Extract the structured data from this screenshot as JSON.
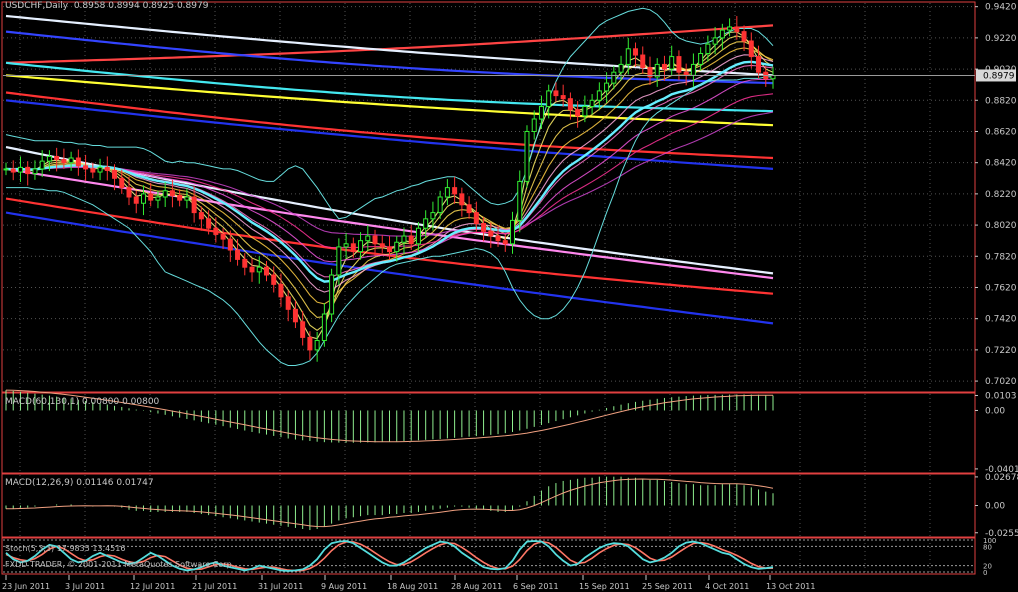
{
  "chart_data": [
    {
      "type": "candlestick",
      "title": "USDCHF,Daily",
      "ohlc_header": [
        "0.8958",
        "0.8994",
        "0.8925",
        "0.8979"
      ],
      "current_price": 0.8979,
      "current_price_label": "0.8979",
      "ylim": [
        0.695,
        0.945
      ],
      "y_ticks": [
        0.702,
        0.722,
        0.742,
        0.762,
        0.782,
        0.802,
        0.822,
        0.842,
        0.862,
        0.882,
        0.902,
        0.922,
        0.942
      ],
      "y_tick_labels": [
        "0.7020",
        "0.7220",
        "0.7420",
        "0.7620",
        "0.7820",
        "0.8020",
        "0.8220",
        "0.8420",
        "0.8620",
        "0.8820",
        "0.9020",
        "0.9220",
        "0.9420"
      ],
      "close": [
        0.838,
        0.836,
        0.839,
        0.835,
        0.838,
        0.843,
        0.846,
        0.844,
        0.842,
        0.845,
        0.84,
        0.838,
        0.836,
        0.839,
        0.837,
        0.832,
        0.826,
        0.82,
        0.816,
        0.822,
        0.818,
        0.82,
        0.824,
        0.821,
        0.818,
        0.82,
        0.81,
        0.806,
        0.8,
        0.796,
        0.793,
        0.786,
        0.78,
        0.775,
        0.772,
        0.775,
        0.77,
        0.764,
        0.756,
        0.748,
        0.74,
        0.73,
        0.722,
        0.728,
        0.745,
        0.77,
        0.788,
        0.79,
        0.785,
        0.792,
        0.795,
        0.79,
        0.788,
        0.785,
        0.791,
        0.795,
        0.79,
        0.8,
        0.806,
        0.81,
        0.82,
        0.826,
        0.822,
        0.815,
        0.81,
        0.803,
        0.798,
        0.795,
        0.792,
        0.79,
        0.805,
        0.83,
        0.862,
        0.87,
        0.878,
        0.888,
        0.885,
        0.883,
        0.876,
        0.872,
        0.878,
        0.882,
        0.888,
        0.893,
        0.9,
        0.905,
        0.915,
        0.911,
        0.903,
        0.897,
        0.905,
        0.902,
        0.91,
        0.9,
        0.898,
        0.905,
        0.912,
        0.918,
        0.922,
        0.927,
        0.929,
        0.926,
        0.92,
        0.91,
        0.9,
        0.8958,
        0.8979
      ],
      "oscillators_on_main": {
        "bollinger_upper": [
          0.86,
          0.859,
          0.858,
          0.857,
          0.856,
          0.856,
          0.856,
          0.856,
          0.855,
          0.855,
          0.854,
          0.854,
          0.853,
          0.853,
          0.852,
          0.852,
          0.852,
          0.852,
          0.852,
          0.851,
          0.849,
          0.846,
          0.843,
          0.842,
          0.843,
          0.842,
          0.842,
          0.841,
          0.84,
          0.839,
          0.838,
          0.838,
          0.837,
          0.835,
          0.833,
          0.831,
          0.83,
          0.83,
          0.834,
          0.838,
          0.84,
          0.838,
          0.832,
          0.826,
          0.819,
          0.812,
          0.806,
          0.807,
          0.81,
          0.813,
          0.816,
          0.819,
          0.82,
          0.822,
          0.824,
          0.825,
          0.827,
          0.828,
          0.83,
          0.831,
          0.832,
          0.833,
          0.833,
          0.831,
          0.827,
          0.823,
          0.819,
          0.816,
          0.815,
          0.816,
          0.818,
          0.825,
          0.838,
          0.853,
          0.868,
          0.883,
          0.894,
          0.903,
          0.91,
          0.915,
          0.92,
          0.925,
          0.93,
          0.933,
          0.935,
          0.937,
          0.939,
          0.94,
          0.941,
          0.94,
          0.937,
          0.932,
          0.926,
          0.922,
          0.92,
          0.919,
          0.918,
          0.919,
          0.921,
          0.924,
          0.926,
          0.928,
          0.928,
          0.928,
          0.926,
          0.922,
          0.917
        ],
        "bollinger_lower": [
          0.826,
          0.826,
          0.826,
          0.826,
          0.825,
          0.825,
          0.824,
          0.824,
          0.823,
          0.821,
          0.819,
          0.817,
          0.815,
          0.812,
          0.809,
          0.806,
          0.803,
          0.8,
          0.795,
          0.79,
          0.785,
          0.778,
          0.772,
          0.77,
          0.768,
          0.766,
          0.764,
          0.762,
          0.76,
          0.757,
          0.754,
          0.75,
          0.745,
          0.739,
          0.733,
          0.727,
          0.722,
          0.718,
          0.714,
          0.712,
          0.712,
          0.713,
          0.715,
          0.72,
          0.728,
          0.736,
          0.744,
          0.75,
          0.755,
          0.76,
          0.764,
          0.768,
          0.772,
          0.775,
          0.777,
          0.778,
          0.779,
          0.78,
          0.781,
          0.782,
          0.782,
          0.783,
          0.784,
          0.785,
          0.786,
          0.787,
          0.786,
          0.784,
          0.78,
          0.772,
          0.762,
          0.754,
          0.748,
          0.744,
          0.742,
          0.742,
          0.744,
          0.748,
          0.754,
          0.762,
          0.772,
          0.784,
          0.797,
          0.81,
          0.822,
          0.835,
          0.846,
          0.856,
          0.864,
          0.87,
          0.874,
          0.877,
          0.88,
          0.883,
          0.886,
          0.889,
          0.892,
          0.894,
          0.895,
          0.895,
          0.895,
          0.895,
          0.896,
          0.896,
          0.896,
          0.897,
          0.897
        ]
      },
      "moving_averages_color_ranges": [
        {
          "color": "#ff4444",
          "level_start": 0.906,
          "level_end": 0.93
        },
        {
          "color": "#3344ff",
          "level_start": 0.926,
          "level_end": 0.893
        },
        {
          "color": "#e6f0ff",
          "level_start": 0.936,
          "level_end": 0.898
        },
        {
          "color": "#44e8f0",
          "level_start": 0.906,
          "level_end": 0.875
        },
        {
          "color": "#ffff33",
          "level_start": 0.898,
          "level_end": 0.866
        },
        {
          "color": "#ff3333",
          "level_start": 0.887,
          "level_end": 0.845
        },
        {
          "color": "#2233ee",
          "level_start": 0.882,
          "level_end": 0.838
        },
        {
          "color": "#ff3333",
          "level_start": 0.819,
          "level_end": 0.758
        },
        {
          "color": "#2233ee",
          "level_start": 0.81,
          "level_end": 0.739
        },
        {
          "color": "#e6f0ff",
          "level_start": 0.852,
          "level_end": 0.771
        },
        {
          "color": "#ff88ee",
          "level_start": 0.838,
          "level_end": 0.768
        }
      ],
      "x_labels": [
        "23 Jun 2011",
        "3 Jul 2011",
        "12 Jul 2011",
        "21 Jul 2011",
        "31 Jul 2011",
        "9 Aug 2011",
        "18 Aug 2011",
        "28 Aug 2011",
        "6 Sep 2011",
        "15 Sep 2011",
        "25 Sep 2011",
        "4 Oct 2011",
        "13 Oct 2011"
      ]
    },
    {
      "type": "histogram",
      "title": "MACD(60,130,1)",
      "values_header": [
        "0.00800",
        "0.00800"
      ],
      "ylim": [
        -0.043,
        0.012
      ],
      "y_tick_labels": [
        "0.0103",
        "0.00",
        "-0.04019"
      ],
      "y_ticks": [
        0.0103,
        0.0,
        -0.04019
      ],
      "hist": [
        0.014,
        0.0134,
        0.0128,
        0.0122,
        0.0115,
        0.0109,
        0.0102,
        0.0095,
        0.0088,
        0.008,
        0.0073,
        0.0065,
        0.0057,
        0.0049,
        0.0041,
        0.0032,
        0.0024,
        0.0015,
        0.0006,
        -0.0003,
        -0.0012,
        -0.0021,
        -0.003,
        -0.004,
        -0.0049,
        -0.0059,
        -0.0068,
        -0.0078,
        -0.0088,
        -0.0098,
        -0.0108,
        -0.0118,
        -0.0128,
        -0.0138,
        -0.0148,
        -0.0157,
        -0.0166,
        -0.0175,
        -0.0184,
        -0.0193,
        -0.02,
        -0.0205,
        -0.021,
        -0.0215,
        -0.0218,
        -0.022,
        -0.0221,
        -0.0222,
        -0.0222,
        -0.0221,
        -0.022,
        -0.0219,
        -0.0217,
        -0.0215,
        -0.0213,
        -0.0211,
        -0.0208,
        -0.0205,
        -0.0202,
        -0.0199,
        -0.0196,
        -0.0192,
        -0.0188,
        -0.0184,
        -0.018,
        -0.0176,
        -0.0172,
        -0.0168,
        -0.0163,
        -0.0156,
        -0.0148,
        -0.0138,
        -0.0126,
        -0.0113,
        -0.01,
        -0.0087,
        -0.0073,
        -0.006,
        -0.0047,
        -0.0034,
        -0.0021,
        -0.0008,
        0.0005,
        0.0017,
        0.0029,
        0.004,
        0.005,
        0.0059,
        0.0067,
        0.0074,
        0.008,
        0.0086,
        0.0091,
        0.0095,
        0.0099,
        0.0102,
        0.0104,
        0.0106,
        0.0107,
        0.0108,
        0.0109,
        0.011,
        0.011,
        0.0109,
        0.0108,
        0.0106,
        0.0103
      ]
    },
    {
      "type": "histogram",
      "title": "MACD(12,26,9)",
      "values_header": [
        "0.01146",
        "0.01747"
      ],
      "ylim": [
        -0.0295,
        0.0295
      ],
      "y_tick_labels": [
        "0.02678",
        "0.00",
        "-0.02553"
      ],
      "y_ticks": [
        0.02678,
        0.0,
        -0.02553
      ],
      "hist": [
        -0.003,
        -0.003,
        -0.002,
        -0.002,
        -0.001,
        0.0,
        0.0,
        0.001,
        0.0,
        0.001,
        0.0,
        0.0,
        -0.001,
        0.0,
        0.0,
        -0.001,
        -0.002,
        -0.004,
        -0.005,
        -0.005,
        -0.006,
        -0.006,
        -0.006,
        -0.006,
        -0.006,
        -0.006,
        -0.007,
        -0.008,
        -0.009,
        -0.01,
        -0.011,
        -0.012,
        -0.013,
        -0.014,
        -0.015,
        -0.016,
        -0.017,
        -0.018,
        -0.019,
        -0.02,
        -0.021,
        -0.022,
        -0.023,
        -0.022,
        -0.02,
        -0.017,
        -0.014,
        -0.012,
        -0.011,
        -0.01,
        -0.009,
        -0.009,
        -0.009,
        -0.008,
        -0.008,
        -0.007,
        -0.007,
        -0.006,
        -0.005,
        -0.004,
        -0.003,
        -0.002,
        -0.001,
        -0.001,
        -0.002,
        -0.003,
        -0.004,
        -0.005,
        -0.006,
        -0.006,
        -0.005,
        -0.001,
        0.004,
        0.009,
        0.014,
        0.018,
        0.021,
        0.023,
        0.024,
        0.025,
        0.026,
        0.026,
        0.027,
        0.027,
        0.027,
        0.027,
        0.026,
        0.026,
        0.025,
        0.024,
        0.024,
        0.023,
        0.022,
        0.021,
        0.02,
        0.02,
        0.019,
        0.019,
        0.019,
        0.02,
        0.02,
        0.02,
        0.019,
        0.017,
        0.015,
        0.013,
        0.0115
      ],
      "signal_approx_tail": 0.01747
    },
    {
      "type": "line",
      "title": "Stoch(5,3,3)",
      "ylim": [
        0,
        100
      ],
      "y_tick_labels": [
        "100",
        "80",
        "20",
        "0"
      ],
      "y_ticks": [
        100,
        80,
        20,
        0
      ],
      "k": [
        60,
        40,
        30,
        35,
        50,
        70,
        85,
        80,
        60,
        40,
        30,
        35,
        50,
        60,
        50,
        40,
        30,
        25,
        30,
        45,
        60,
        50,
        35,
        20,
        10,
        5,
        8,
        15,
        25,
        30,
        20,
        15,
        10,
        5,
        10,
        20,
        15,
        10,
        5,
        3,
        5,
        8,
        20,
        40,
        70,
        90,
        95,
        97,
        90,
        75,
        60,
        45,
        30,
        20,
        20,
        30,
        45,
        60,
        75,
        85,
        95,
        92,
        80,
        60,
        45,
        30,
        15,
        10,
        8,
        12,
        35,
        70,
        95,
        97,
        95,
        80,
        55,
        35,
        20,
        25,
        45,
        60,
        75,
        85,
        90,
        88,
        80,
        60,
        40,
        30,
        35,
        45,
        60,
        80,
        92,
        95,
        90,
        80,
        70,
        60,
        55,
        40,
        25,
        15,
        10,
        12,
        15
      ],
      "d": [
        55,
        45,
        38,
        35,
        42,
        55,
        72,
        80,
        73,
        58,
        43,
        35,
        38,
        48,
        53,
        50,
        40,
        32,
        28,
        33,
        45,
        52,
        48,
        35,
        22,
        12,
        8,
        9,
        16,
        23,
        25,
        22,
        15,
        10,
        8,
        12,
        15,
        15,
        10,
        6,
        4,
        5,
        11,
        23,
        43,
        67,
        85,
        94,
        94,
        87,
        75,
        60,
        45,
        32,
        23,
        23,
        32,
        45,
        60,
        73,
        85,
        91,
        89,
        77,
        62,
        45,
        30,
        18,
        11,
        10,
        18,
        39,
        67,
        87,
        95,
        91,
        77,
        57,
        37,
        27,
        30,
        43,
        60,
        73,
        83,
        88,
        86,
        76,
        60,
        43,
        35,
        37,
        47,
        62,
        77,
        89,
        92,
        88,
        80,
        70,
        62,
        52,
        40,
        27,
        17,
        12,
        12
      ]
    }
  ],
  "footer": {
    "stoch_title": "Stoch(5,3,3) 17.9835 13.4516",
    "copyright": "FXDD TRADER, © 2001-2011 MetaQuotes Software Corp."
  },
  "colors": {
    "background": "#000000",
    "grid": "#525252",
    "frame": "#e04040",
    "bull": "#33ee33",
    "bear": "#ff3333",
    "hist_up": "#8fef8f",
    "hist_down": "#8fef8f",
    "macd_signal": "#f0a080",
    "stoch_k": "#55dddd",
    "stoch_d": "#ff7766",
    "bollinger": "#66dddd",
    "fan_yellow": "#ffff66"
  }
}
